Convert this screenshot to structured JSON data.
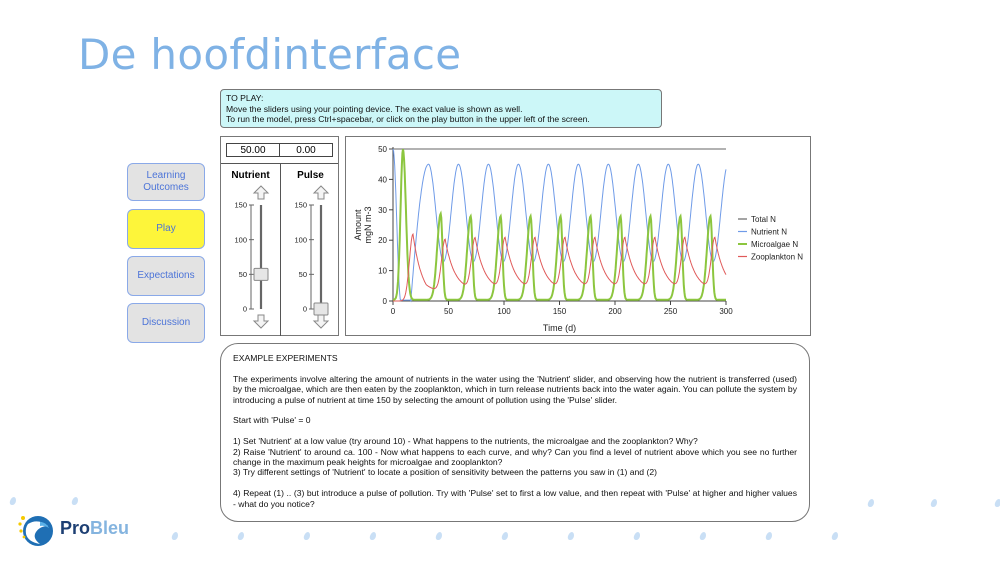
{
  "slide": {
    "title": "De hoofdinterface"
  },
  "instructions": {
    "heading": "TO PLAY:",
    "lines": [
      "Move the sliders using your pointing device. The exact value is shown as well.",
      "To run the model, press Ctrl+spacebar, or click on the play button in the upper left of the screen."
    ]
  },
  "nav": {
    "items": [
      {
        "label": "Learning Outcomes",
        "active": false
      },
      {
        "label": "Play",
        "active": true
      },
      {
        "label": "Expectations",
        "active": false
      },
      {
        "label": "Discussion",
        "active": false
      }
    ],
    "active_color": "#fdf53a",
    "text_color": "#4c74d8"
  },
  "sliders": [
    {
      "label": "Nutrient",
      "value_text": "50.00",
      "value": 50,
      "min": 0,
      "max": 150,
      "ticks": [
        "150",
        "100",
        "50",
        "0"
      ]
    },
    {
      "label": "Pulse",
      "value_text": "0.00",
      "value": 0,
      "min": 0,
      "max": 150,
      "ticks": [
        "150",
        "100",
        "50",
        "0"
      ]
    }
  ],
  "chart_data": {
    "type": "line",
    "title": "",
    "xlabel": "Time (d)",
    "ylabel": "Amount mgN m-3",
    "ylabel_lines": [
      "Amount",
      "mgN m-3"
    ],
    "xlim": [
      0,
      300
    ],
    "ylim": [
      0,
      50
    ],
    "xticks": [
      0,
      50,
      100,
      150,
      200,
      250,
      300
    ],
    "yticks": [
      0,
      10,
      20,
      30,
      40,
      50
    ],
    "grid": false,
    "legend_position": "right",
    "series": [
      {
        "name": "Total N",
        "color": "#666666",
        "model": "constant",
        "level": 50
      },
      {
        "name": "Nutrient N",
        "color": "#6f9be8",
        "model": "oscillation",
        "initial": 50,
        "first_min_time": 7,
        "first_min": 0,
        "min": 13,
        "max": 45,
        "period": 27,
        "first_peak_time": 32
      },
      {
        "name": "Microalgae N",
        "color": "#8cc63f",
        "model": "pulses",
        "first_peak_time": 9,
        "first_peak": 50,
        "peak": 27.5,
        "second_peak_time": 43,
        "period": 27,
        "baseline": 0.5
      },
      {
        "name": "Zooplankton N",
        "color": "#e05a5a",
        "model": "pulses",
        "first_peak_time": 18,
        "first_peak": 22,
        "peak": 20,
        "second_peak_time": 47,
        "period": 27,
        "trough": 3.2
      }
    ],
    "legend": [
      "Total N",
      "Nutrient N",
      "Microalgae N",
      "Zooplankton N"
    ]
  },
  "examples": {
    "heading": "EXAMPLE EXPERIMENTS",
    "intro": "The experiments involve altering the amount of nutrients in the water using the 'Nutrient' slider, and observing how the nutrient is transferred (used) by the microalgae, which are then eaten by the zooplankton, which in turn release nutrients back into the water again. You can pollute the system by introducing a pulse of nutrient at time 150 by selecting the amount of pollution using the 'Pulse' slider.",
    "start": "Start with 'Pulse' = 0",
    "steps": [
      "1) Set 'Nutrient' at a low value (try around 10) - What happens to the nutrients, the microalgae and the zooplankton? Why?",
      "2) Raise 'Nutrient' to around ca. 100 - Now what happens to each curve, and why? Can you find a level of nutrient above which you see no further change in the maximum peak heights for microalgae and zooplankton?",
      "3) Try different settings of 'Nutrient' to locate a position of sensitivity between the patterns you saw in (1) and (2)"
    ],
    "step4": "4) Repeat (1) .. (3) but introduce a pulse of pollution. Try with 'Pulse' set to first a low value, and then repeat with 'Pulse' at higher and higher values - what do you notice?"
  },
  "logo": {
    "text_dark": "Pro",
    "text_light": "Bleu",
    "dark_color": "#1d3f73",
    "light_color": "#5b9bd5",
    "icon": "probleu-swirl-icon"
  },
  "colors": {
    "title": "#7fb2e5",
    "instructions_bg": "#ccf7f8",
    "decor_dots": "#c9dff5"
  }
}
